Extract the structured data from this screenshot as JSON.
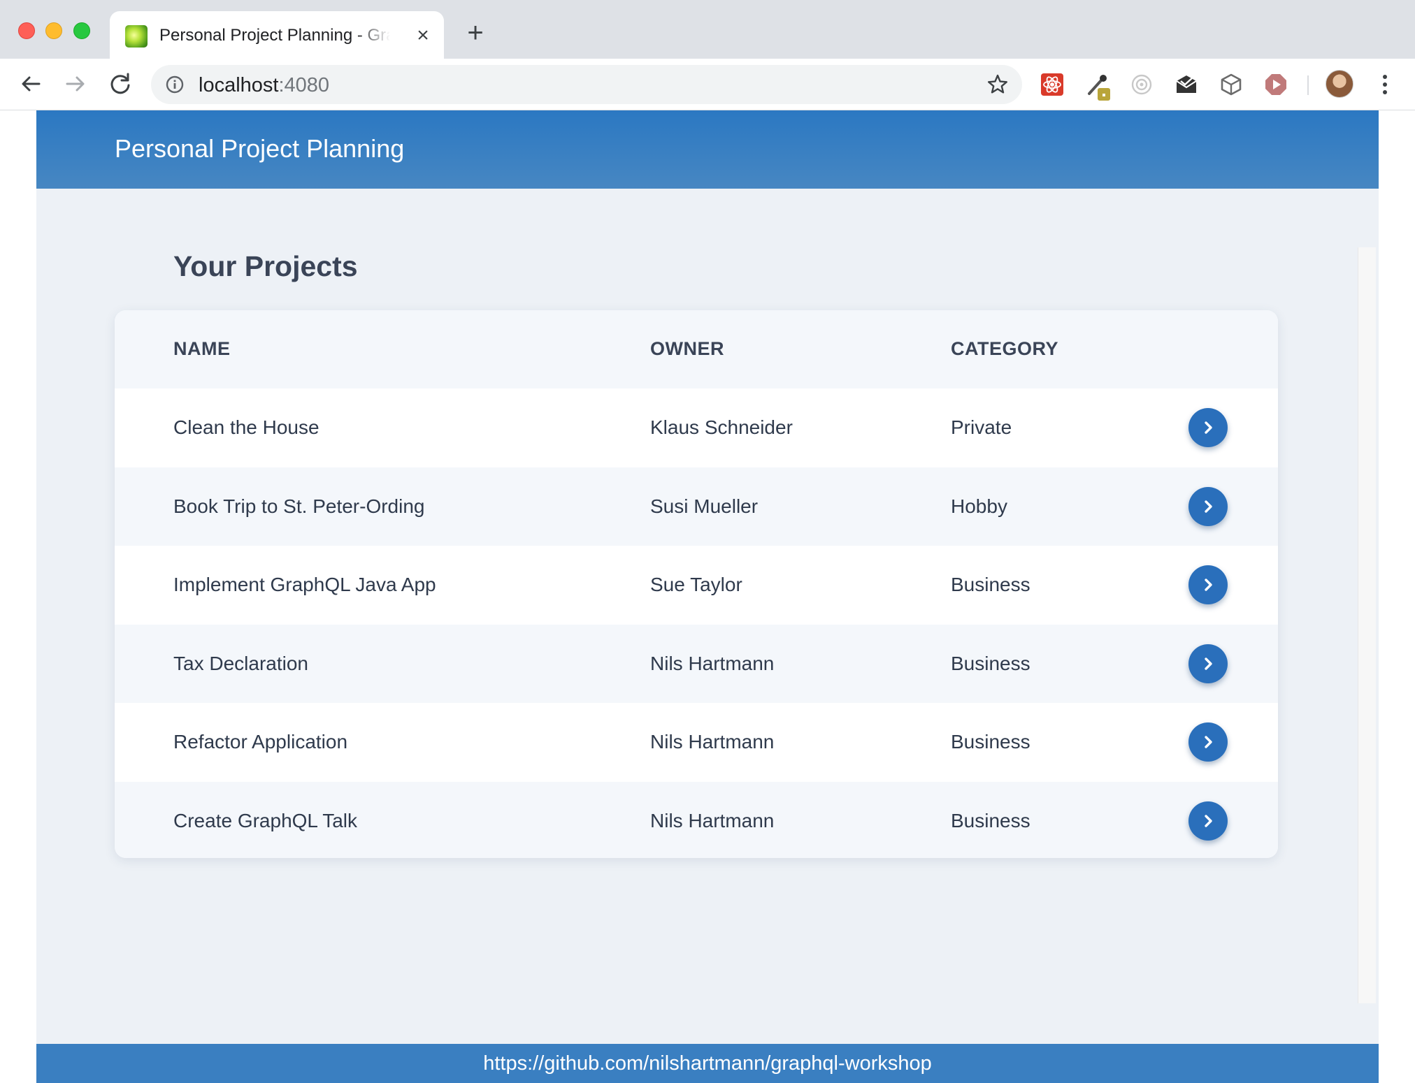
{
  "browser": {
    "tab": {
      "title": "Personal Project Planning - GraphQL Workshop",
      "favicon": "app-favicon"
    },
    "address": {
      "host": "localhost",
      "port": ":4080"
    },
    "extensions": [
      "react-devtools-icon",
      "color-picker-icon",
      "circle-target-icon",
      "mail-icon",
      "cube-icon",
      "play-icon"
    ],
    "accent": "#2b78c2"
  },
  "app": {
    "title": "Personal Project Planning",
    "section_title": "Your Projects",
    "table": {
      "columns": [
        "NAME",
        "OWNER",
        "CATEGORY"
      ],
      "rows": [
        {
          "name": "Clean the House",
          "owner": "Klaus Schneider",
          "category": "Private"
        },
        {
          "name": "Book Trip to St. Peter-Ording",
          "owner": "Susi Mueller",
          "category": "Hobby"
        },
        {
          "name": "Implement GraphQL Java App",
          "owner": "Sue Taylor",
          "category": "Business"
        },
        {
          "name": "Tax Declaration",
          "owner": "Nils Hartmann",
          "category": "Business"
        },
        {
          "name": "Refactor Application",
          "owner": "Nils Hartmann",
          "category": "Business"
        },
        {
          "name": "Create GraphQL Talk",
          "owner": "Nils Hartmann",
          "category": "Business"
        }
      ],
      "row_action_icon": "chevron-right-icon"
    },
    "footer_link": "https://github.com/nilshartmann/graphql-workshop",
    "colors": {
      "header": "#2b78c2",
      "background": "#edf1f6",
      "button": "#2a6fbb"
    }
  }
}
